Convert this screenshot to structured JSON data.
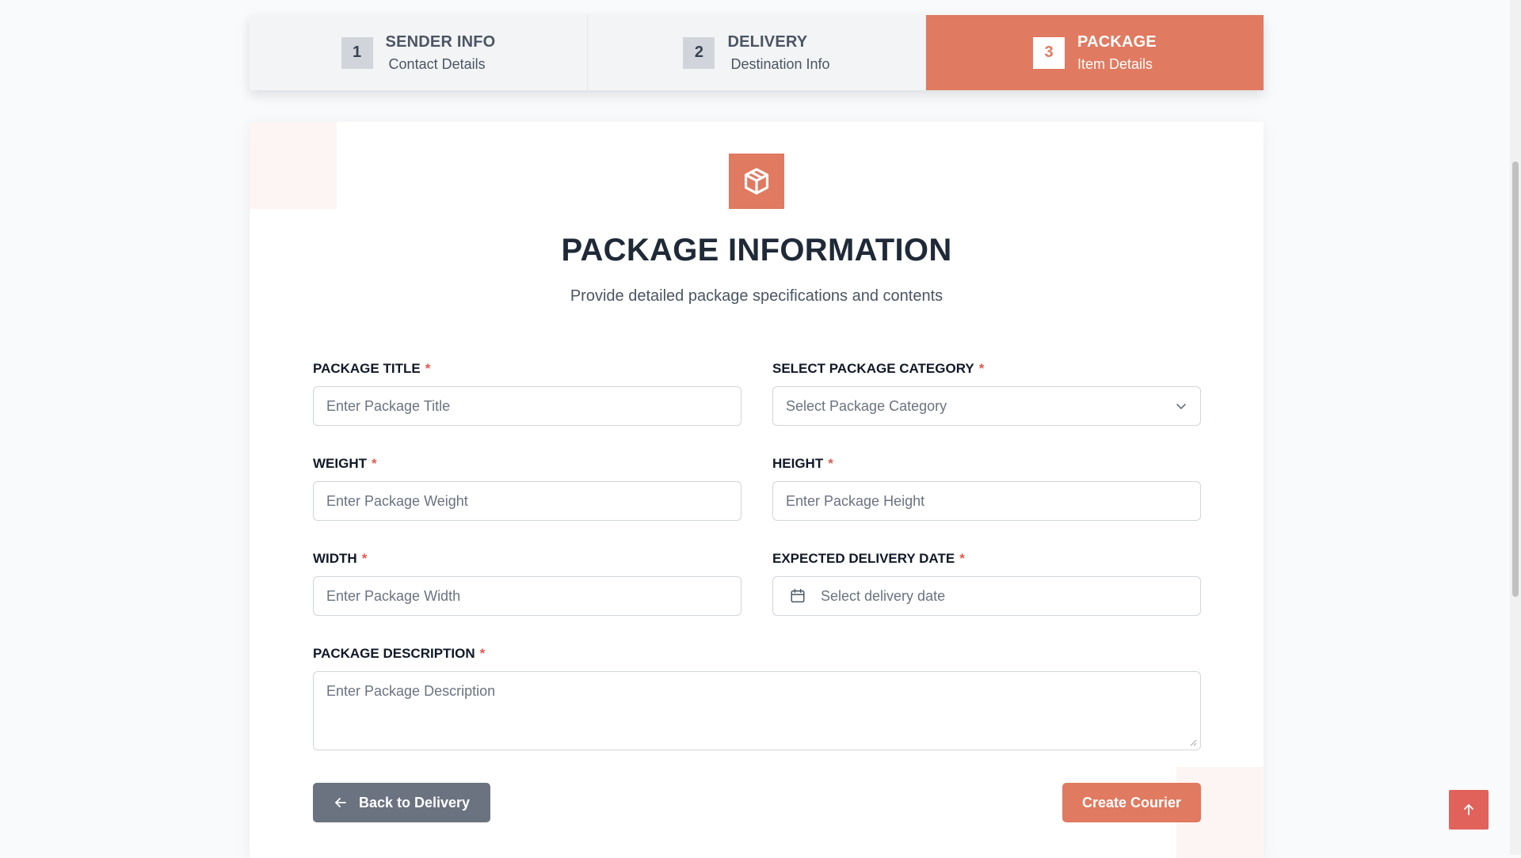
{
  "stepper": {
    "steps": [
      {
        "number": "1",
        "title": "SENDER INFO",
        "subtitle": "Contact Details",
        "active": false
      },
      {
        "number": "2",
        "title": "DELIVERY",
        "subtitle": "Destination Info",
        "active": false
      },
      {
        "number": "3",
        "title": "PACKAGE",
        "subtitle": "Item Details",
        "active": true
      }
    ]
  },
  "header": {
    "icon": "package-box-icon",
    "title": "PACKAGE INFORMATION",
    "subtitle": "Provide detailed package specifications and contents"
  },
  "form": {
    "required_mark": "*",
    "package_title": {
      "label": "PACKAGE TITLE",
      "value": "",
      "placeholder": "Enter Package Title"
    },
    "package_category": {
      "label": "SELECT PACKAGE CATEGORY",
      "selected": "Select Package Category",
      "icon": "chevron-down-icon"
    },
    "weight": {
      "label": "WEIGHT",
      "value": "",
      "placeholder": "Enter Package Weight"
    },
    "height": {
      "label": "HEIGHT",
      "value": "",
      "placeholder": "Enter Package Height"
    },
    "width": {
      "label": "WIDTH",
      "value": "",
      "placeholder": "Enter Package Width"
    },
    "delivery_date": {
      "label": "EXPECTED DELIVERY DATE",
      "value": "",
      "placeholder": "Select delivery date",
      "icon": "calendar-icon"
    },
    "description": {
      "label": "PACKAGE DESCRIPTION",
      "value": "",
      "placeholder": "Enter Package Description"
    }
  },
  "actions": {
    "back_label": "Back to Delivery",
    "back_icon": "arrow-left-icon",
    "create_label": "Create Courier"
  },
  "scroll_top": {
    "icon": "arrow-up-icon"
  },
  "colors": {
    "accent": "#e07a60",
    "scroll_top_bg": "#e0625a",
    "back_button": "#6b7280",
    "required": "#e05a4f",
    "heading": "#1f2937"
  }
}
